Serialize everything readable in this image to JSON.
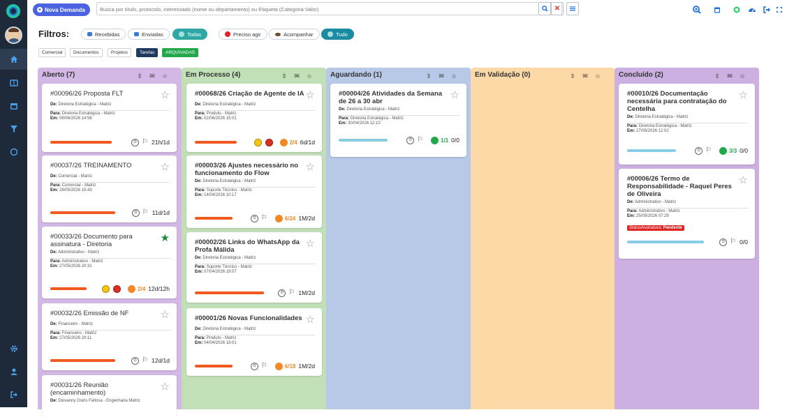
{
  "topbar": {
    "new_button": "Nova Demanda",
    "search_placeholder": "Busca por título, protocolo, interessado (nome ou departamento) ou Etiqueta (Categoria:Valor)"
  },
  "filters": {
    "title": "Filtros:",
    "chips": [
      "Recebidas",
      "Enviadas",
      "Todas",
      "Preciso agir",
      "Acompanhar",
      "Tudo"
    ],
    "tags": [
      "Comercial",
      "Documentos",
      "Projetos",
      "Tarefas",
      "ARQUIVADAS"
    ]
  },
  "labels": {
    "de": "De:",
    "para": "Para:",
    "em": "Em:",
    "status_label": "StatusAssinatura:",
    "status_value": "Pendente"
  },
  "columns": [
    {
      "title": "Aberto (7)",
      "cards": [
        {
          "title": "#00096/26 Proposta FLT",
          "de": "Diretoria Estratégica - Matriz",
          "para": "Diretoria Estratégica - Matriz",
          "em": "08/06/2026 14:58",
          "time": "21h/1d"
        },
        {
          "title": "#00037/26 TREINAMENTO",
          "de": "Comercial - Matriz",
          "para": "Comercial - Matriz",
          "em": "28/05/2026 15:43",
          "time": "11d/1d"
        },
        {
          "title": "#00033/26 Documento para assinatura - Diretoria",
          "de": "Administrativo - Matriz",
          "para": "Administrativo - Matriz",
          "em": "27/05/2026 20:31",
          "count": "2/4",
          "time": "12d/12h"
        },
        {
          "title": "#00032/26 Emissão de NF",
          "de": "Financeiro - Matriz",
          "para": "Financeiro - Matriz",
          "em": "27/05/2026 20:11",
          "time": "12d/1d"
        },
        {
          "title": "#00031/26 Reunião (encaminhamento)",
          "de": "Diovanny Osiris Feitosa - Engenharia Matriz"
        }
      ]
    },
    {
      "title": "Em Processo (4)",
      "cards": [
        {
          "title": "#00068/26 Criação de Agente de IA",
          "de": "Diretoria Estratégica - Matriz",
          "para": "Produto - Matriz",
          "em": "02/06/2026 15:01",
          "count": "2/4",
          "time": "6d/1d"
        },
        {
          "title": "#00003/26 Ajustes necessário no funcionamento do Flow",
          "de": "Diretoria Estratégica - Matriz",
          "para": "Suporte Técnico - Matriz",
          "em": "14/04/2026 10:17",
          "count": "6/24",
          "time": "1M/2d"
        },
        {
          "title": "#00002/26 Links do WhatsApp da Profa Málida",
          "de": "Diretoria Estratégica - Matriz",
          "para": "Suporte Técnico - Matriz",
          "em": "07/04/2026 19:07",
          "time": "1M/2d"
        },
        {
          "title": "#00001/26 Novas Funcionalidades",
          "de": "Diretoria Estratégica - Matriz",
          "para": "Produto - Matriz",
          "em": "04/04/2026 18:01",
          "count": "6/18",
          "time": "1M/2d"
        }
      ]
    },
    {
      "title": "Aguardando (1)",
      "cards": [
        {
          "title": "#00004/26 Atividades da Semana de 26 a 30 abr",
          "de": "Diretoria Estratégica - Matriz",
          "para": "Diretoria Estratégica - Matriz",
          "em": "30/04/2026 12:10",
          "count": "1/1",
          "time": "0/0"
        }
      ]
    },
    {
      "title": "Em Validação (0)",
      "cards": []
    },
    {
      "title": "Concluído (2)",
      "cards": [
        {
          "title": "#00010/26 Documentação necessária para contratação do Centelha",
          "de": "Diretoria Estratégica - Matriz",
          "para": "Diretoria Estratégica - Matriz",
          "em": "27/05/2026 12:02",
          "count": "3/3",
          "time": "0/0"
        },
        {
          "title": "#00006/26 Termo de Responsabilidade - Raquel Peres de Oliveira",
          "de": "Administrativo - Matriz",
          "para": "Administrativo - Matriz",
          "em": "25/05/2026 07:29",
          "time": "0/0"
        }
      ]
    }
  ]
}
